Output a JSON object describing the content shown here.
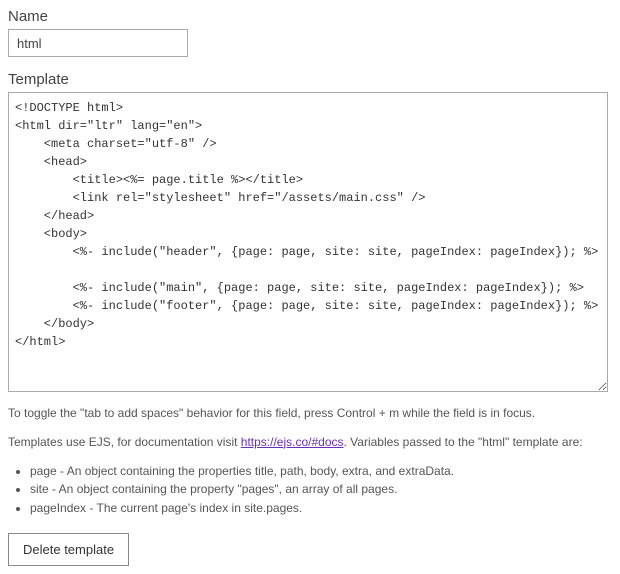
{
  "name": {
    "label": "Name",
    "value": "html"
  },
  "template": {
    "label": "Template",
    "value": "<!DOCTYPE html>\n<html dir=\"ltr\" lang=\"en\">\n    <meta charset=\"utf-8\" />\n    <head>\n        <title><%= page.title %></title>\n        <link rel=\"stylesheet\" href=\"/assets/main.css\" />\n    </head>\n    <body>\n        <%- include(\"header\", {page: page, site: site, pageIndex: pageIndex}); %>\n\n        <%- include(\"main\", {page: page, site: site, pageIndex: pageIndex}); %>\n        <%- include(\"footer\", {page: page, site: site, pageIndex: pageIndex}); %>\n    </body>\n</html>"
  },
  "help": {
    "tab_toggle": "To toggle the \"tab to add spaces\" behavior for this field, press Control + m while the field is in focus.",
    "ejs_prefix": "Templates use EJS, for documentation visit ",
    "ejs_link_text": "https://ejs.co/#docs",
    "ejs_link_href": "https://ejs.co/#docs",
    "ejs_suffix": ". Variables passed to the \"html\" template are:",
    "variables": [
      "page - An object containing the properties title, path, body, extra, and extraData.",
      "site - An object containing the property \"pages\", an array of all pages.",
      "pageIndex - The current page's index in site.pages."
    ]
  },
  "actions": {
    "delete_label": "Delete template"
  }
}
